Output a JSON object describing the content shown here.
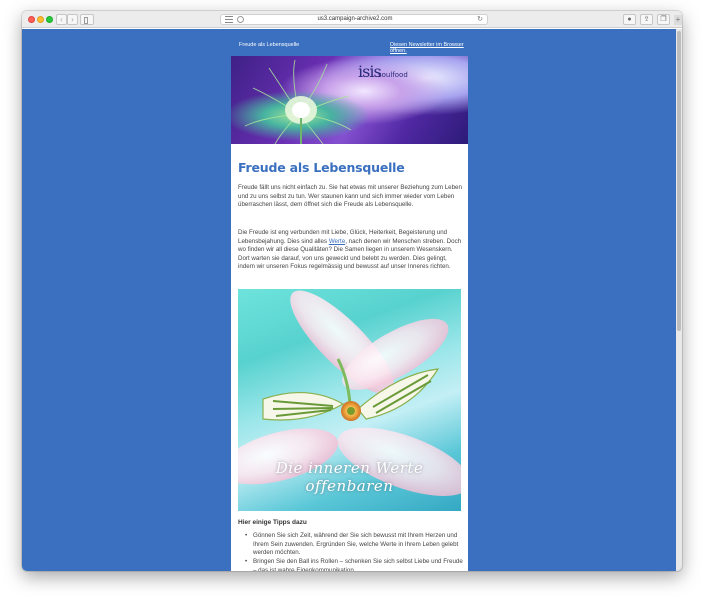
{
  "browser": {
    "url": "us3.campaign-archive2.com",
    "back_icon": "chevron-left-icon",
    "forward_icon": "chevron-right-icon"
  },
  "preheader": {
    "title": "Freude als Lebensquelle",
    "browser_link": "Diesen Newsletter im Browser öffnen."
  },
  "banner": {
    "logo_mark": "isis",
    "logo_text": "soulfood"
  },
  "article": {
    "headline": "Freude als Lebensquelle",
    "para1": "Freude fällt uns nicht einfach zu. Sie hat etwas mit unserer Beziehung zum Leben und zu uns selbst zu tun. Wer staunen kann und sich immer wieder vom Leben überraschen lässt, dem öffnet sich die Freude als Lebensquelle.",
    "para2_before": "Die Freude ist eng verbunden mit Liebe, Glück, Heiterkeit, Begeisterung und Lebensbejahung. Dies sind alles ",
    "para2_link": "Werte",
    "para2_after": ", nach denen wir Menschen streben. Doch wo finden wir all diese Qualitäten? Die Samen liegen in unserem Wesenskern. Dort warten sie darauf, von uns geweckt und belebt zu werden. Dies gelingt, indem wir unseren Fokus regelmässig und bewusst auf unser Inneres richten.",
    "image_caption": "Die inneren Werte offenbaren",
    "tips_heading": "Hier einige Tipps dazu",
    "tips": [
      "Gönnen Sie sich Zeit, während der Sie sich bewusst mit Ihrem Herzen und Ihrem Sein zuwenden. Ergründen Sie, welche Werte in Ihrem Leben gelebt werden möchten.",
      "Bringen Sie den Ball ins Rollen – schenken Sie sich selbst Liebe und Freude – das ist wahre Eigenkommunikation."
    ]
  }
}
